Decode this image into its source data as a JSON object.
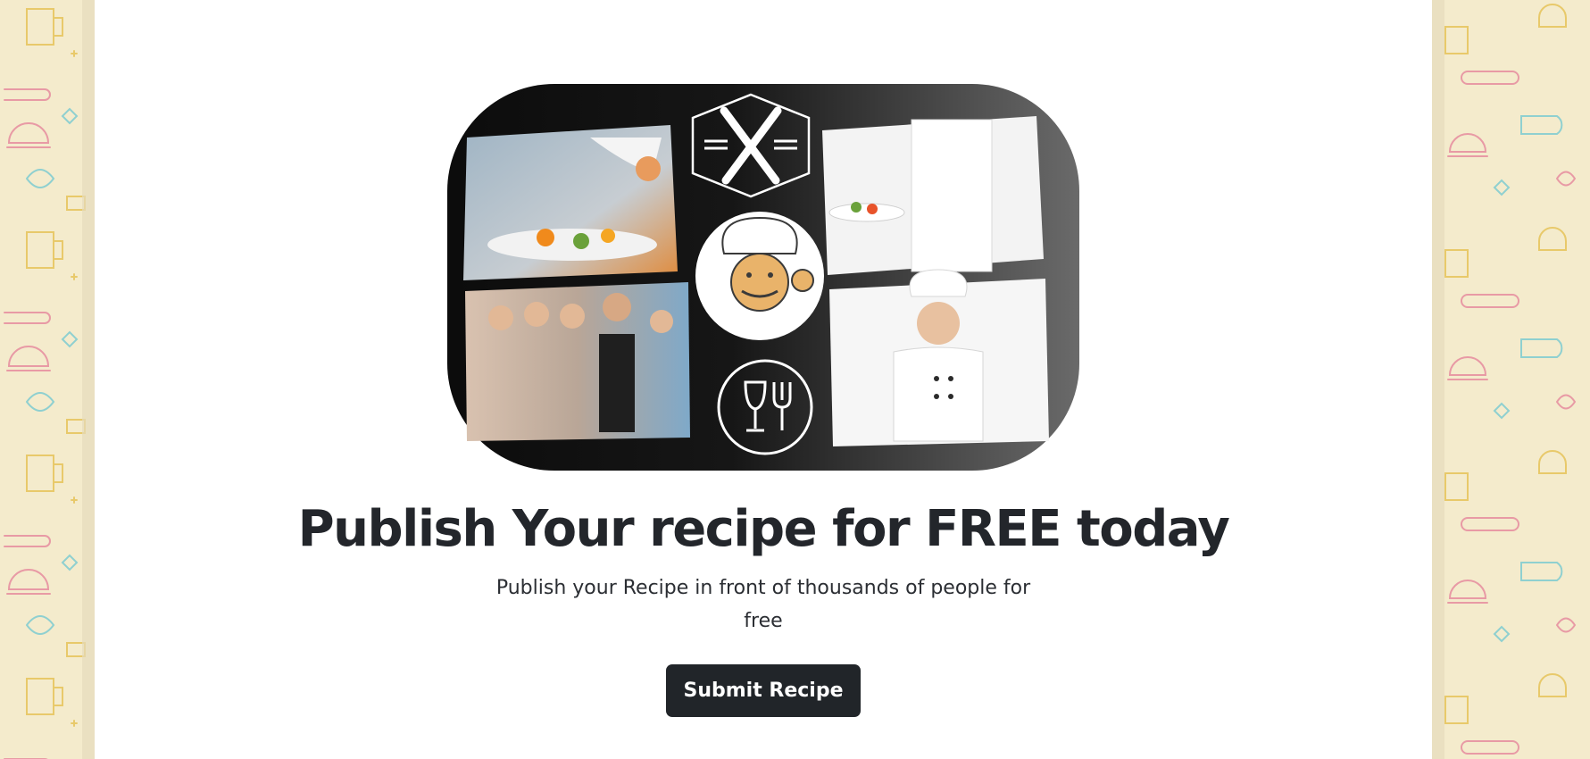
{
  "hero": {
    "title": "Publish Your recipe for FREE today",
    "subtitle": "Publish your Recipe in front of thousands of people for free",
    "cta_label": "Submit Recipe"
  },
  "banner": {
    "photos": [
      "chef-plating-food",
      "chef-holding-salad-plate",
      "restaurant-staff-group",
      "smiling-chef-portrait"
    ],
    "icons": [
      "crossed-forks-hexagon-icon",
      "chef-mascot-icon",
      "glass-and-fork-icon"
    ]
  },
  "colors": {
    "page_background": "#ffffff",
    "side_pattern_background": "#f4ebcc",
    "title_text": "#23262b",
    "button_background": "#212529",
    "button_text": "#ffffff",
    "banner_dark": "#0c0c0c",
    "banner_light": "#6a6a6a"
  }
}
